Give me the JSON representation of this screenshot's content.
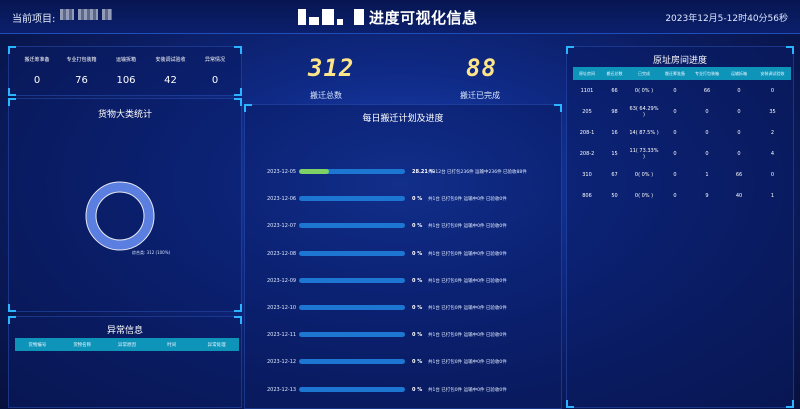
{
  "header": {
    "project_label": "当前项目:",
    "title": "进度可视化信息",
    "datetime": "2023年12月5-12时40分56秒"
  },
  "status": {
    "headers": [
      "搬迁筹准备",
      "专业打包装箱",
      "运输拆箱",
      "安装调试验收",
      "异常情况"
    ],
    "values": [
      "0",
      "76",
      "106",
      "42",
      "0"
    ]
  },
  "cargo": {
    "title": "货物大类统计",
    "legend": "综合类: 312 (100%)",
    "accent": "#5b7fe0"
  },
  "abnormal": {
    "title": "异常信息",
    "headers": [
      "货物编号",
      "货物名称",
      "异常原因",
      "时间",
      "异常处理"
    ]
  },
  "summary": {
    "total_value": "312",
    "total_label": "搬迁总数",
    "done_value": "88",
    "done_label": "搬迁已完成"
  },
  "plan": {
    "title": "每日搬迁计划及进度",
    "rows": [
      {
        "date": "2023-12-05",
        "progress": 0.2821,
        "pct": "28.21 %",
        "info": "共312台  已打包236件  运输中236件  已验收88件"
      },
      {
        "date": "2023-12-06",
        "progress": 0,
        "pct": "0 %",
        "info": "共1台  已打包0件  运输中0件  已验收0件"
      },
      {
        "date": "2023-12-07",
        "progress": 0,
        "pct": "0 %",
        "info": "共1台  已打包0件  运输中0件  已验收0件"
      },
      {
        "date": "2023-12-08",
        "progress": 0,
        "pct": "0 %",
        "info": "共1台  已打包0件  运输中0件  已验收0件"
      },
      {
        "date": "2023-12-09",
        "progress": 0,
        "pct": "0 %",
        "info": "共1台  已打包0件  运输中0件  已验收0件"
      },
      {
        "date": "2023-12-10",
        "progress": 0,
        "pct": "0 %",
        "info": "共1台  已打包0件  运输中0件  已验收0件"
      },
      {
        "date": "2023-12-11",
        "progress": 0,
        "pct": "0 %",
        "info": "共1台  已打包0件  运输中0件  已验收0件"
      },
      {
        "date": "2023-12-12",
        "progress": 0,
        "pct": "0 %",
        "info": "共1台  已打包0件  运输中0件  已验收0件"
      },
      {
        "date": "2023-12-13",
        "progress": 0,
        "pct": "0 %",
        "info": "共1台  已打包0件  运输中0件  已验收0件"
      }
    ]
  },
  "rooms": {
    "title": "原址房间进度",
    "headers": [
      "原址房间",
      "搬迁总数",
      "已完成",
      "搬迁筹准备",
      "专业打包装箱",
      "运输拆箱",
      "安装调试验收"
    ],
    "rows": [
      [
        "1101",
        "66",
        "0( 0% )",
        "0",
        "66",
        "0",
        "0"
      ],
      [
        "205",
        "98",
        "63( 64.29% )",
        "0",
        "0",
        "0",
        "35"
      ],
      [
        "208-1",
        "16",
        "14( 87.5% )",
        "0",
        "0",
        "0",
        "2"
      ],
      [
        "208-2",
        "15",
        "11( 73.33% )",
        "0",
        "0",
        "0",
        "4"
      ],
      [
        "310",
        "67",
        "0( 0% )",
        "0",
        "1",
        "66",
        "0"
      ],
      [
        "806",
        "50",
        "0( 0% )",
        "0",
        "9",
        "40",
        "1"
      ]
    ]
  },
  "colors": {
    "progress_fill": "#7dd165",
    "progress_track": "#1d77d2",
    "table_header": "#0e93b9",
    "number_yellow": "#ffe58a",
    "corner": "#2bb4ff"
  }
}
